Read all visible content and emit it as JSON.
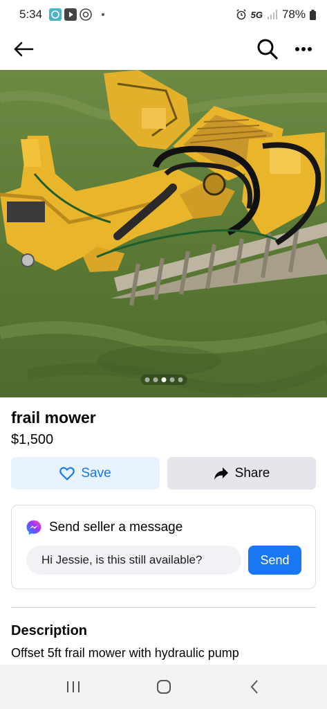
{
  "status_bar": {
    "time": "5:34",
    "network": "5G",
    "battery": "78%"
  },
  "listing": {
    "title": "frail mower",
    "price": "$1,500",
    "photo_indicator": {
      "count": 5,
      "active_index": 2
    }
  },
  "actions": {
    "save_label": "Save",
    "share_label": "Share"
  },
  "message": {
    "heading": "Send seller a message",
    "input_value": "Hi Jessie, is this still available?",
    "send_label": "Send"
  },
  "description": {
    "heading": "Description",
    "body": "Offset 5ft frail mower with hydraulic pump"
  },
  "colors": {
    "accent": "#1877f2",
    "save_bg": "#e7f3ff",
    "share_bg": "#e4e6eb",
    "machine_yellow": "#e9b52a"
  },
  "icons": {
    "back": "arrow-left-icon",
    "search": "search-icon",
    "more": "more-horizontal-icon",
    "save": "heart-outline-icon",
    "share": "share-arrow-icon",
    "messenger": "messenger-icon",
    "nav_recents": "recents-icon",
    "nav_home": "home-icon",
    "nav_back": "chevron-left-icon"
  }
}
